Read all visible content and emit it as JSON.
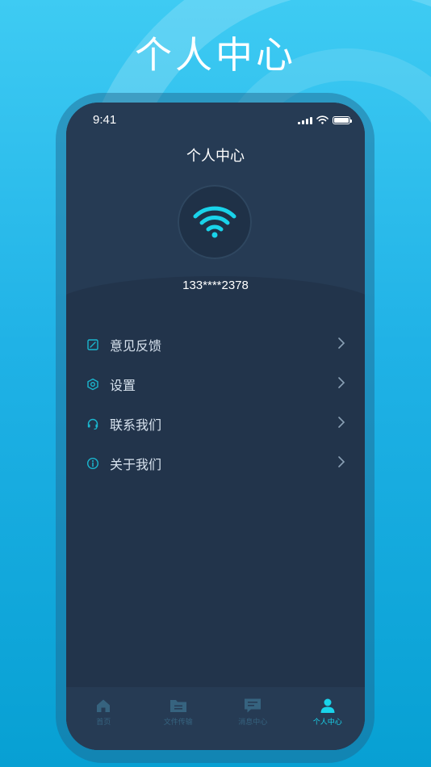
{
  "hero": {
    "title": "个人中心"
  },
  "status_bar": {
    "time": "9:41"
  },
  "header": {
    "title": "个人中心"
  },
  "profile": {
    "phone": "133****2378",
    "avatar_icon": "wifi-icon"
  },
  "menu": {
    "items": [
      {
        "label": "意见反馈",
        "icon": "feedback-edit-icon"
      },
      {
        "label": "设置",
        "icon": "settings-hex-icon"
      },
      {
        "label": "联系我们",
        "icon": "headset-icon"
      },
      {
        "label": "关于我们",
        "icon": "info-icon"
      }
    ]
  },
  "tabbar": {
    "tabs": [
      {
        "label": "首页",
        "icon": "home-icon",
        "active": false
      },
      {
        "label": "文件传输",
        "icon": "folder-icon",
        "active": false
      },
      {
        "label": "消息中心",
        "icon": "message-icon",
        "active": false
      },
      {
        "label": "个人中心",
        "icon": "user-icon",
        "active": true
      }
    ]
  },
  "colors": {
    "accent": "#19d3ea",
    "screen_bg": "#22344b",
    "header_bg": "#263b54",
    "inactive_tab": "#36637f"
  }
}
